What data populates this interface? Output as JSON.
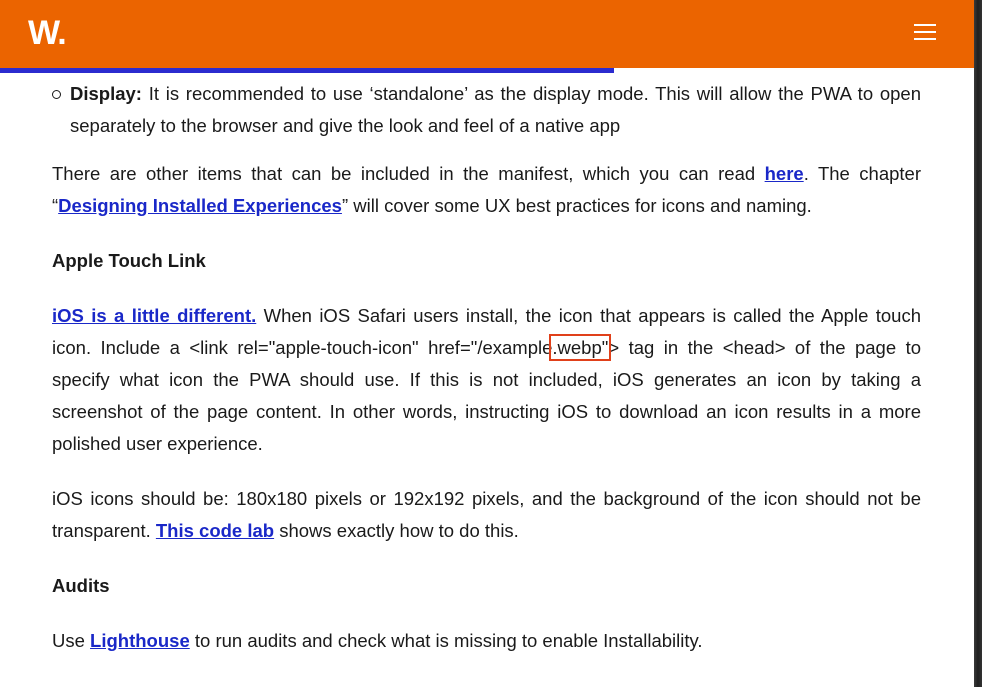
{
  "header": {
    "logo": "W.",
    "menu_icon": "hamburger-menu-icon",
    "accent_color": "#eb6400"
  },
  "progress": {
    "fraction": 0.63,
    "color": "#2b2bcf"
  },
  "article": {
    "bullet": {
      "term": "Display:",
      "text": " It is recommended to use ‘standalone’ as the display mode. This will allow the PWA to open separately to the browser and give the look and feel of a native app"
    },
    "p1": {
      "t1": "There are other items that can be included in the manifest, which you can read ",
      "link1": "here",
      "t2": ". The chapter “",
      "link2": "Designing Installed Experiences",
      "t3": "” will cover some UX best practices for icons and naming."
    },
    "h_apple": "Apple Touch Link",
    "p2": {
      "link": "iOS is a little different.",
      "t1": " When iOS Safari users install, the icon that appears is called the Apple touch icon. Include a <link rel=\"apple-touch-icon\" href=\"/example",
      "hl": ".webp\"",
      "t2": "> tag in the <head> of the page to specify what icon the PWA should use. If this is not included, iOS generates an icon by taking a screenshot of the page content. In other words, instructing iOS to download an icon results in a more polished user experience."
    },
    "p3": {
      "t1": "iOS icons should be: 180x180 pixels or 192x192 pixels, and the background of the icon should not be transparent. ",
      "link": "This code lab",
      "t2": " shows exactly how to do this."
    },
    "h_audits": "Audits",
    "p4": {
      "t1": "Use ",
      "link": "Lighthouse",
      "t2": " to run audits and check what is missing to enable Installability."
    }
  }
}
